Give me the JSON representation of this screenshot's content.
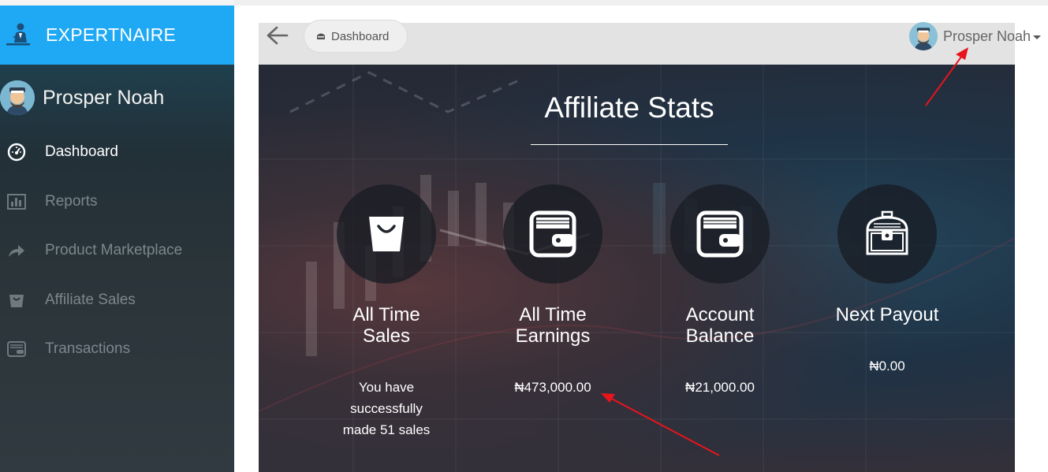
{
  "brand": {
    "name": "EXPERTNAIRE",
    "color": "#1fa9f4"
  },
  "profile": {
    "name": "Prosper Noah"
  },
  "sidebar": {
    "items": [
      {
        "label": "Dashboard",
        "icon": "speedometer-icon",
        "active": true
      },
      {
        "label": "Reports",
        "icon": "bar-chart-icon",
        "active": false
      },
      {
        "label": "Product Marketplace",
        "icon": "share-arrow-icon",
        "active": false
      },
      {
        "label": "Affiliate Sales",
        "icon": "basket-icon",
        "active": false
      },
      {
        "label": "Transactions",
        "icon": "wallet-icon",
        "active": false
      }
    ]
  },
  "header": {
    "breadcrumb": "Dashboard",
    "user_name": "Prosper Noah"
  },
  "stats": {
    "title": "Affiliate Stats",
    "cards": [
      {
        "label_line1": "All Time",
        "label_line2": "Sales",
        "icon": "shopping-bag-icon",
        "value_lines": [
          "You have",
          "successfully",
          "made 51 sales"
        ]
      },
      {
        "label_line1": "All Time",
        "label_line2": "Earnings",
        "icon": "wallet-icon",
        "value_lines": [
          "₦473,000.00"
        ]
      },
      {
        "label_line1": "Account",
        "label_line2": "Balance",
        "icon": "wallet-icon",
        "value_lines": [
          "₦21,000.00"
        ]
      },
      {
        "label_line1": "Next Payout",
        "label_line2": "",
        "icon": "treasure-chest-icon",
        "value_lines": [
          "₦0.00"
        ]
      }
    ]
  },
  "annotation_color": "#e8141c"
}
